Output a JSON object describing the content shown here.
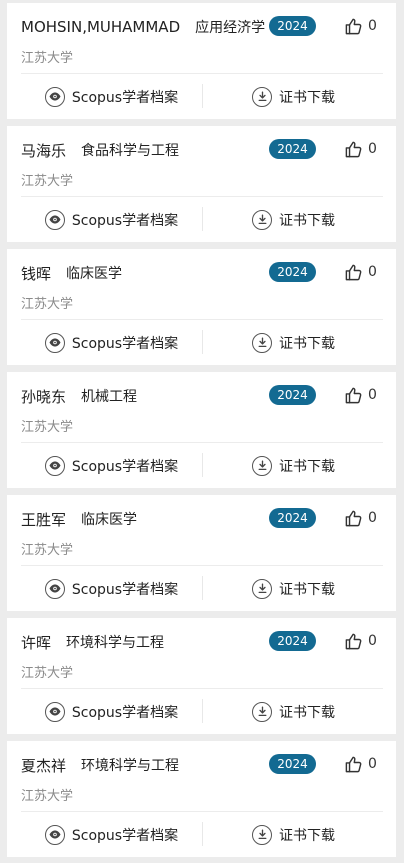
{
  "university": "江苏大学",
  "scopus_label": "Scopus学者档案",
  "certificate_label": "证书下载",
  "colors": {
    "badge": "#136a92",
    "background": "#ececec",
    "card": "#ffffff"
  },
  "icons": {
    "like": "thumbs-up-icon",
    "scopus": "eye-icon",
    "download": "download-icon"
  },
  "records": [
    {
      "name": "MOHSIN,MUHAMMAD",
      "major": "应用经济学",
      "year": "2024",
      "likes": "0"
    },
    {
      "name": "马海乐",
      "major": "食品科学与工程",
      "year": "2024",
      "likes": "0"
    },
    {
      "name": "钱晖",
      "major": "临床医学",
      "year": "2024",
      "likes": "0"
    },
    {
      "name": "孙晓东",
      "major": "机械工程",
      "year": "2024",
      "likes": "0"
    },
    {
      "name": "王胜军",
      "major": "临床医学",
      "year": "2024",
      "likes": "0"
    },
    {
      "name": "许晖",
      "major": "环境科学与工程",
      "year": "2024",
      "likes": "0"
    },
    {
      "name": "夏杰祥",
      "major": "环境科学与工程",
      "year": "2024",
      "likes": "0"
    }
  ]
}
